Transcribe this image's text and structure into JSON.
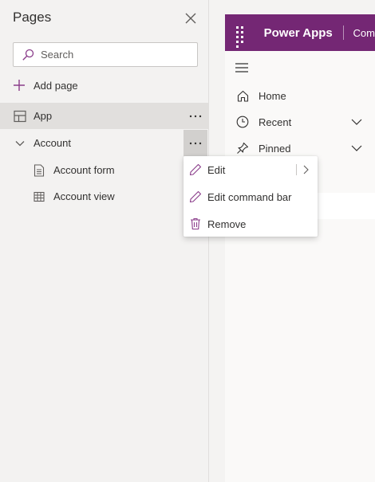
{
  "pane": {
    "title": "Pages",
    "search_placeholder": "Search",
    "add_page_label": "Add page",
    "items": [
      {
        "label": "App",
        "icon": "app-layout-icon",
        "selected": true
      },
      {
        "label": "Account",
        "icon": "chevron-down-icon",
        "expanded": true
      },
      {
        "label": "Account form",
        "icon": "form-icon"
      },
      {
        "label": "Account view",
        "icon": "grid-view-icon"
      }
    ]
  },
  "context_menu": {
    "items": [
      {
        "label": "Edit",
        "icon": "pencil-icon",
        "has_submenu": true
      },
      {
        "label": "Edit command bar",
        "icon": "pencil-icon"
      },
      {
        "label": "Remove",
        "icon": "trash-icon"
      }
    ]
  },
  "preview": {
    "brand": "Power Apps",
    "breadcrumb_partial": "Com",
    "nav": [
      {
        "label": "Home",
        "icon": "home-icon"
      },
      {
        "label": "Recent",
        "icon": "clock-icon",
        "expandable": true
      },
      {
        "label": "Pinned",
        "icon": "pin-icon",
        "expandable": true
      }
    ]
  },
  "colors": {
    "brand_bar": "#742774",
    "accent_icon": "#8a3c8a",
    "pane_bg": "#f3f2f1",
    "selected_row": "#e1dfdd"
  }
}
